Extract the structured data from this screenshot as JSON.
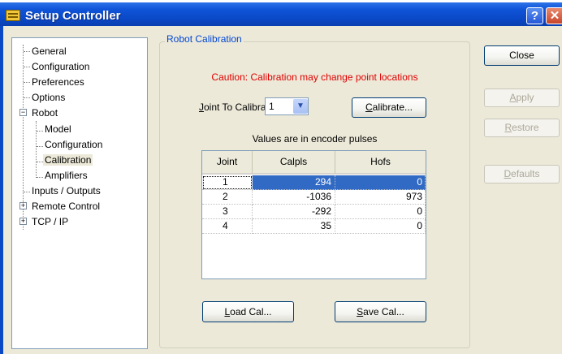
{
  "window": {
    "title": "Setup Controller"
  },
  "tree": {
    "items": [
      {
        "label": "General"
      },
      {
        "label": "Configuration"
      },
      {
        "label": "Preferences"
      },
      {
        "label": "Options"
      },
      {
        "label": "Robot",
        "expander": "−"
      },
      {
        "label": "Model"
      },
      {
        "label": "Configuration"
      },
      {
        "label": "Calibration",
        "selected": true
      },
      {
        "label": "Amplifiers"
      },
      {
        "label": "Inputs / Outputs"
      },
      {
        "label": "Remote Control",
        "expander": "+"
      },
      {
        "label": "TCP / IP",
        "expander": "+"
      }
    ]
  },
  "calibration": {
    "group_label": "Robot Calibration",
    "caution": "Caution: Calibration may change point locations",
    "joint_label_key": "J",
    "joint_label_rest": "oint To Calibrate:",
    "joint_value": "1",
    "calibrate_key": "C",
    "calibrate_rest": "alibrate...",
    "encoder_note": "Values are in encoder pulses",
    "table": {
      "headers": [
        "Joint",
        "Calpls",
        "Hofs"
      ],
      "rows": [
        {
          "joint": "1",
          "calpls": "294",
          "hofs": "0"
        },
        {
          "joint": "2",
          "calpls": "-1036",
          "hofs": "973"
        },
        {
          "joint": "3",
          "calpls": "-292",
          "hofs": "0"
        },
        {
          "joint": "4",
          "calpls": "35",
          "hofs": "0"
        }
      ]
    },
    "load_key": "L",
    "load_rest": "oad Cal...",
    "save_key": "S",
    "save_rest": "ave Cal..."
  },
  "side_buttons": {
    "close": "Close",
    "apply_key": "A",
    "apply_rest": "pply",
    "restore_key": "R",
    "restore_rest": "estore",
    "defaults_key": "D",
    "defaults_rest": "efaults"
  },
  "colors": {
    "title_bar": "#0a48c6",
    "selection": "#316ac5",
    "caution": "#e00000",
    "group_label": "#0046d5"
  }
}
